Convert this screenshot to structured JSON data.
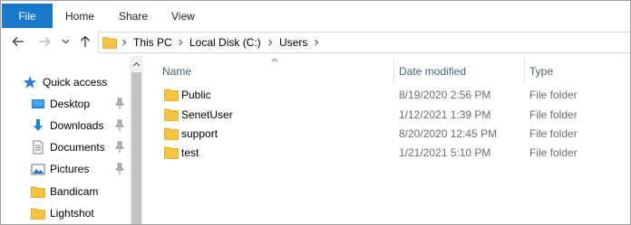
{
  "ribbon": {
    "tabs": [
      "File",
      "Home",
      "Share",
      "View"
    ]
  },
  "address": {
    "crumbs": [
      "This PC",
      "Local Disk (C:)",
      "Users"
    ]
  },
  "nav": {
    "quick_access": "Quick access",
    "items": [
      {
        "label": "Desktop",
        "icon": "desktop-icon",
        "pinned": true
      },
      {
        "label": "Downloads",
        "icon": "download-icon",
        "pinned": true
      },
      {
        "label": "Documents",
        "icon": "documents-icon",
        "pinned": true
      },
      {
        "label": "Pictures",
        "icon": "pictures-icon",
        "pinned": true
      },
      {
        "label": "Bandicam",
        "icon": "folder-icon",
        "pinned": false
      },
      {
        "label": "Lightshot",
        "icon": "folder-icon",
        "pinned": false
      }
    ]
  },
  "columns": {
    "name": "Name",
    "date": "Date modified",
    "type": "Type"
  },
  "files": [
    {
      "name": "Public",
      "date": "8/19/2020 2:56 PM",
      "type": "File folder"
    },
    {
      "name": "SenetUser",
      "date": "1/12/2021 1:39 PM",
      "type": "File folder"
    },
    {
      "name": "support",
      "date": "8/20/2020 12:45 PM",
      "type": "File folder"
    },
    {
      "name": "test",
      "date": "1/21/2021 5:10 PM",
      "type": "File folder"
    }
  ],
  "colors": {
    "accent": "#1979ca",
    "folder": "#f5c542",
    "header_text": "#4c607a",
    "detail_text": "#6d6d6d"
  }
}
